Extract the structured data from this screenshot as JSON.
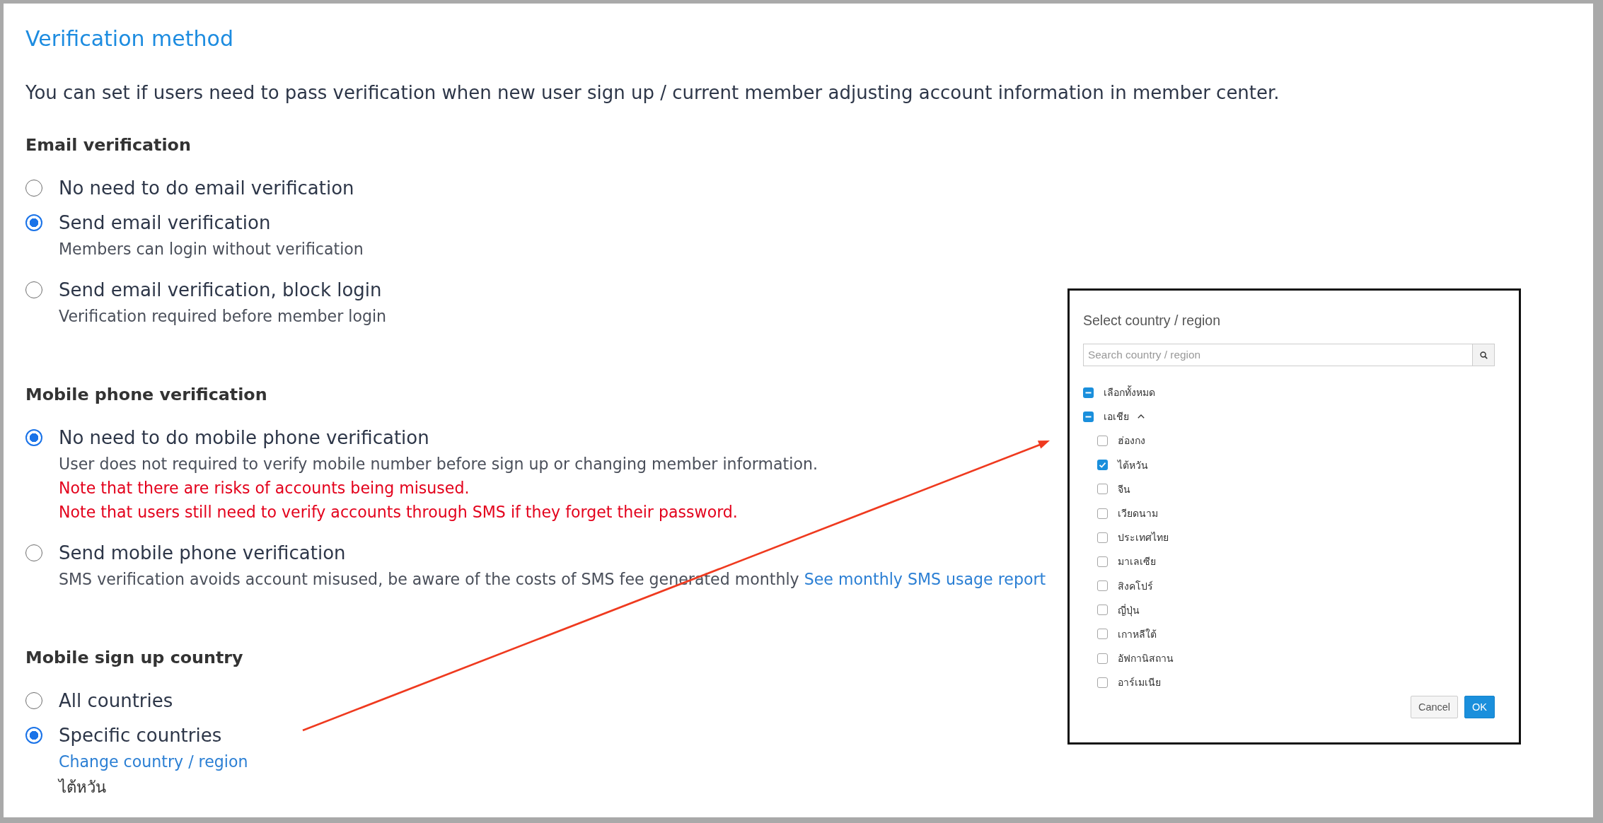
{
  "page": {
    "title": "Verification method",
    "description": "You can set if users need to pass verification when new user sign up / current member adjusting account information in member center."
  },
  "sections": [
    {
      "heading": "Email verification",
      "options": [
        {
          "label": "No need to do email verification",
          "selected": false
        },
        {
          "label": "Send email verification",
          "selected": true,
          "notes": [
            {
              "kind": "hint",
              "text": "Members can login without verification"
            }
          ]
        },
        {
          "label": "Send email verification, block login",
          "selected": false,
          "notes": [
            {
              "kind": "hint",
              "text": "Verification required before member login"
            }
          ]
        }
      ]
    },
    {
      "heading": "Mobile phone verification",
      "options": [
        {
          "label": "No need to do mobile phone verification",
          "selected": true,
          "notes": [
            {
              "kind": "hint",
              "text": "User does not required to verify mobile number before sign up or changing member information."
            },
            {
              "kind": "warning",
              "text": "Note that there are risks of accounts being misused."
            },
            {
              "kind": "warning",
              "text": "Note that users still need to verify accounts through SMS if they forget their password."
            }
          ]
        },
        {
          "label": "Send mobile phone verification",
          "selected": false,
          "notes": [
            {
              "kind": "hint",
              "text": "SMS verification avoids account misused, be aware of the costs of SMS fee generated monthly",
              "link": "See monthly SMS usage report"
            }
          ]
        }
      ]
    },
    {
      "heading": "Mobile sign up country",
      "options": [
        {
          "label": "All countries",
          "selected": false
        },
        {
          "label": "Specific countries",
          "selected": true,
          "notes": [
            {
              "kind": "link",
              "text": "Change country / region"
            },
            {
              "kind": "value",
              "text": "ไต้หวัน"
            }
          ]
        }
      ]
    }
  ],
  "country_dialog": {
    "title": "Select country / region",
    "search": {
      "placeholder": "Search country / region"
    },
    "select_all": {
      "label": "เลือกทั้งหมด",
      "indeterminate": true
    },
    "groups": [
      {
        "label": "เอเชีย",
        "indeterminate": true,
        "expanded": true,
        "children": [
          {
            "label": "ฮ่องกง",
            "checked": false
          },
          {
            "label": "ไต้หวัน",
            "checked": true
          },
          {
            "label": "จีน",
            "checked": false
          },
          {
            "label": "เวียดนาม",
            "checked": false
          },
          {
            "label": "ประเทศไทย",
            "checked": false
          },
          {
            "label": "มาเลเซีย",
            "checked": false
          },
          {
            "label": "สิงคโปร์",
            "checked": false
          },
          {
            "label": "ญี่ปุ่น",
            "checked": false
          },
          {
            "label": "เกาหลีใต้",
            "checked": false
          },
          {
            "label": "อัฟกานิสถาน",
            "checked": false
          },
          {
            "label": "อาร์เมเนีย",
            "checked": false
          }
        ]
      }
    ],
    "buttons": [
      {
        "label": "Cancel",
        "kind": "secondary"
      },
      {
        "label": "OK",
        "kind": "primary"
      }
    ]
  }
}
